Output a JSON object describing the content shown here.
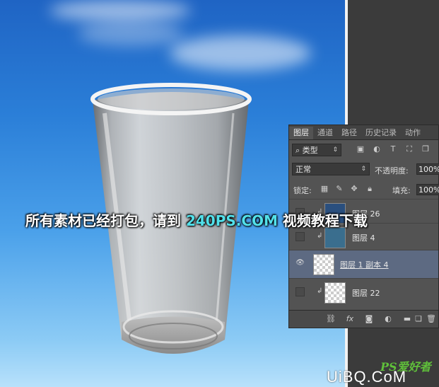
{
  "panel": {
    "tabs": [
      "图层",
      "通道",
      "路径",
      "历史记录",
      "动作"
    ],
    "active_tab": 0,
    "filter": {
      "kind_label": "类型"
    },
    "blend_mode": "正常",
    "opacity_label": "不透明度:",
    "opacity_value": "100%",
    "lock_label": "锁定:",
    "fill_label": "填充:",
    "fill_value": "100%",
    "layers": [
      {
        "name": "图层 26",
        "selected": false
      },
      {
        "name": "图层 4",
        "selected": false
      },
      {
        "name": "图层 1 副本 4",
        "selected": true
      },
      {
        "name": "图层 22",
        "selected": false
      }
    ],
    "footer_icons": [
      "link-icon",
      "fx-icon",
      "mask-icon",
      "adjustment-icon",
      "folder-icon",
      "new-layer-icon",
      "trash-icon"
    ]
  },
  "overlay": {
    "prefix": "所有素材已经打包，请到 ",
    "highlight": "240PS.COM",
    "suffix": " 视频教程下载"
  },
  "watermark": {
    "ps": "PS爱好者",
    "site": "UiBQ.CoM"
  },
  "colors": {
    "highlight": "#52e0ea",
    "selected_layer": "#5d6a82",
    "sky_top": "#1f64c4",
    "sky_bottom": "#b8e1fb"
  }
}
